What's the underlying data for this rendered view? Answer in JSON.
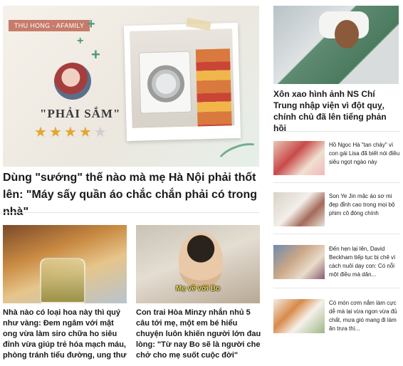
{
  "hero": {
    "brand_tag": "THU HONG - AFAMILY",
    "quote": "\"PHẢI SẮM\"",
    "rating": {
      "value": 4,
      "max": 5
    },
    "title": "Dùng \"sướng\" thế nào mà mẹ Hà Nội phải thốt lên: \"Máy sấy quần áo chắc chắn phải có trong nhà\""
  },
  "cards": [
    {
      "title": "Nhà nào có loại hoa này thì quý như vàng: Đem ngâm với mật ong vừa làm siro chữa ho siêu đỉnh vừa giúp trẻ hóa mạch máu, phòng tránh tiểu đường, ung thư"
    },
    {
      "image_caption": "Mẹ về với Bo",
      "title": "Con trai Hòa Minzy nhắn nhủ 5 câu tới mẹ, một em bé hiểu chuyện luôn khiến người lớn đau lòng: \"Từ nay Bo sẽ là người che chở cho mẹ suốt cuộc đời\""
    }
  ],
  "sidebar": {
    "featured_title": "Xôn xao hình ảnh NS Chí Trung nhập viện vì đột quỵ, chính chủ đã lên tiếng phản hồi",
    "items": [
      {
        "text": "Hồ Ngọc Hà \"tan chảy\" vì con gái Lisa đã biết nói điều siêu ngọt ngào này"
      },
      {
        "text": "Son Ye Jin mặc áo sơ mi đẹp đỉnh cao trong mọi bộ phim cô đóng chính"
      },
      {
        "text": "Đến hẹn lại lên, David Beckham tiếp tục bị chê vì cách nuôi dạy con: Có nỗi một điều mà dân..."
      },
      {
        "text": "Có món cơm nắm làm cực dễ mà lại vừa ngon vừa đủ chất, mưa gió mang đi làm ăn trưa thì..."
      }
    ]
  },
  "colors": {
    "accent_green": "#4a9a7a",
    "star_gold": "#e4a62e",
    "brand_tag_bg": "#c77b6a",
    "caption_yellow": "#f5e24a"
  }
}
